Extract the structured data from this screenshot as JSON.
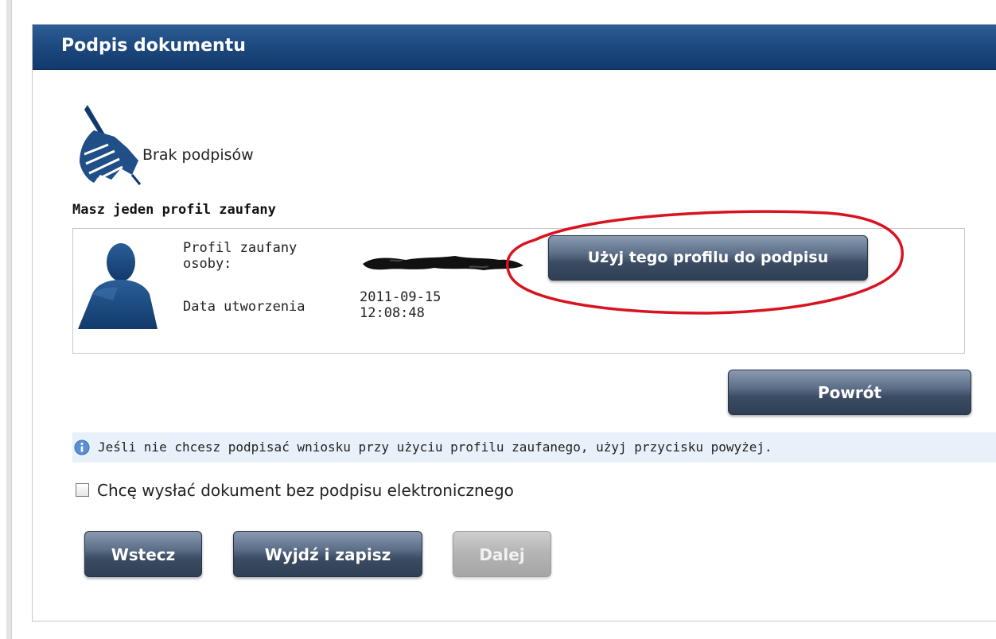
{
  "panel": {
    "title": "Podpis dokumentu"
  },
  "signatures": {
    "status": "Brak podpisów"
  },
  "profile": {
    "heading": "Masz jeden profil zaufany",
    "owner_label": "Profil zaufany osoby:",
    "date_label": "Data utworzenia",
    "date_value": "2011-09-15 12:08:48",
    "use_button_label": "Użyj tego profilu do podpisu"
  },
  "back_button_label": "Powrót",
  "info": {
    "text": "Jeśli nie chcesz podpisać wniosku przy użyciu profilu zaufanego, użyj przycisku powyżej."
  },
  "checkbox": {
    "label": "Chcę wysłać dokument bez podpisu elektronicznego",
    "checked": false
  },
  "nav": {
    "prev_label": "Wstecz",
    "exit_label": "Wyjdź i zapisz",
    "next_label": "Dalej"
  },
  "colors": {
    "header": "#1d4a80",
    "button": "#3b4c63",
    "annotation": "#d9121f",
    "info_bg": "#e8f1fa"
  },
  "icons": {
    "signature": "signature-pen-icon",
    "profile": "person-silhouette-icon",
    "info": "info-icon"
  }
}
